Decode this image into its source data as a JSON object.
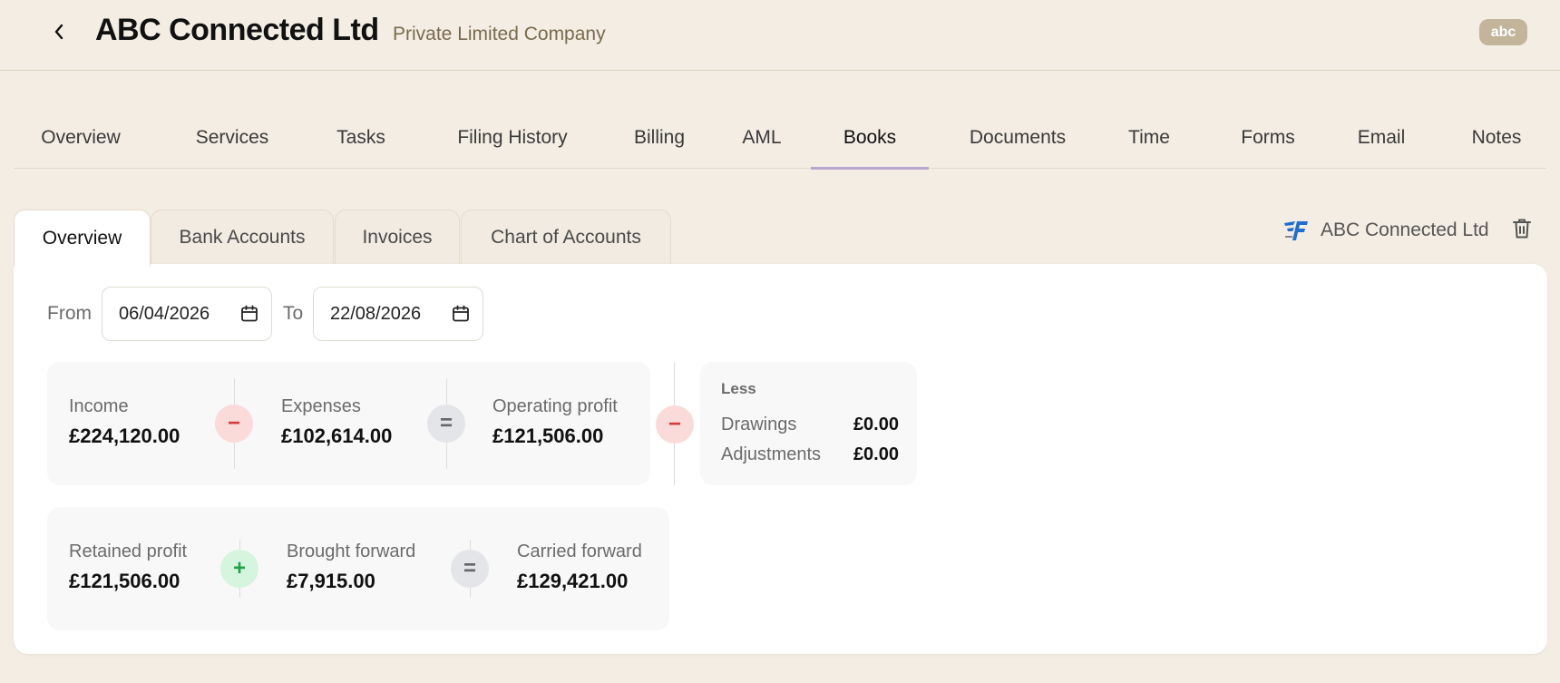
{
  "header": {
    "title": "ABC Connected Ltd",
    "subtitle": "Private Limited Company",
    "avatar": "abc"
  },
  "main_tabs": [
    {
      "label": "Overview"
    },
    {
      "label": "Services"
    },
    {
      "label": "Tasks"
    },
    {
      "label": "Filing History"
    },
    {
      "label": "Billing"
    },
    {
      "label": "AML"
    },
    {
      "label": "Books",
      "active": true
    },
    {
      "label": "Documents"
    },
    {
      "label": "Time"
    },
    {
      "label": "Forms"
    },
    {
      "label": "Email"
    },
    {
      "label": "Notes"
    }
  ],
  "sub_tabs": [
    {
      "label": "Overview",
      "active": true
    },
    {
      "label": "Bank Accounts"
    },
    {
      "label": "Invoices"
    },
    {
      "label": "Chart of Accounts"
    }
  ],
  "integration": {
    "name": "ABC Connected Ltd",
    "icon": "freeagent-logo-icon"
  },
  "filters": {
    "from_label": "From",
    "from_value": "06/04/2026",
    "to_label": "To",
    "to_value": "22/08/2026"
  },
  "operating": {
    "income": {
      "label": "Income",
      "value": "£224,120.00"
    },
    "expenses": {
      "label": "Expenses",
      "value": "£102,614.00"
    },
    "operating_profit": {
      "label": "Operating profit",
      "value": "£121,506.00"
    }
  },
  "less": {
    "title": "Less",
    "rows": [
      {
        "label": "Drawings",
        "value": "£0.00"
      },
      {
        "label": "Adjustments",
        "value": "£0.00"
      }
    ]
  },
  "retained": {
    "retained_profit": {
      "label": "Retained profit",
      "value": "£121,506.00"
    },
    "brought_forward": {
      "label": "Brought forward",
      "value": "£7,915.00"
    },
    "carried_forward": {
      "label": "Carried forward",
      "value": "£129,421.00"
    }
  },
  "colors": {
    "background": "#f3ede3",
    "active_tab_underline": "#b8a6cf",
    "minus": "#d83a3a",
    "plus": "#1ea34a",
    "avatar": "#c2b59a"
  }
}
